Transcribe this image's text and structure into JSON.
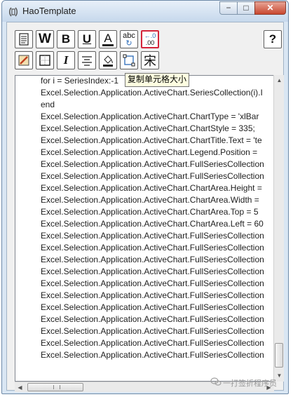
{
  "window": {
    "title": "HaoTemplate",
    "minimize_label": "−",
    "maximize_label": "□",
    "close_label": "✕"
  },
  "toolbar": {
    "bold_label": "B",
    "underline_label": "U",
    "text_color_label": "A",
    "spell_label": "abc",
    "decimal_top": "←.0",
    "decimal_bottom": ".00",
    "help_label": "?",
    "italic_label": "I",
    "font_label": "宋",
    "word_label": "W"
  },
  "tooltip": {
    "text": "复制单元格大小"
  },
  "editor": {
    "lines": [
      "for i = SeriesIndex:-1",
      "Excel.Selection.Application.ActiveChart.SeriesCollection(i).I",
      "end",
      "Excel.Selection.Application.ActiveChart.ChartType = 'xlBar",
      "Excel.Selection.Application.ActiveChart.ChartStyle = 335;",
      "Excel.Selection.Application.ActiveChart.ChartTitle.Text = 'te",
      "Excel.Selection.Application.ActiveChart.Legend.Position = ",
      "Excel.Selection.Application.ActiveChart.FullSeriesCollection",
      "Excel.Selection.Application.ActiveChart.FullSeriesCollection",
      "Excel.Selection.Application.ActiveChart.ChartArea.Height = ",
      "Excel.Selection.Application.ActiveChart.ChartArea.Width = ",
      "Excel.Selection.Application.ActiveChart.ChartArea.Top = 5",
      "Excel.Selection.Application.ActiveChart.ChartArea.Left = 60",
      "Excel.Selection.Application.ActiveChart.FullSeriesCollection",
      "Excel.Selection.Application.ActiveChart.FullSeriesCollection",
      "Excel.Selection.Application.ActiveChart.FullSeriesCollection",
      "Excel.Selection.Application.ActiveChart.FullSeriesCollection",
      "Excel.Selection.Application.ActiveChart.FullSeriesCollection",
      "Excel.Selection.Application.ActiveChart.FullSeriesCollection",
      "Excel.Selection.Application.ActiveChart.FullSeriesCollection",
      "Excel.Selection.Application.ActiveChart.FullSeriesCollection",
      "Excel.Selection.Application.ActiveChart.FullSeriesCollection",
      "Excel.Selection.Application.ActiveChart.FullSeriesCollection",
      "Excel.Selection.Application.ActiveChart.FullSeriesCollection"
    ]
  },
  "watermark": {
    "text": "一打签折程序员"
  },
  "colors": {
    "tooltip_bg": "#ffffe1",
    "pressed_border": "#d4243a",
    "title_gradient_top": "#e8f0f9",
    "title_gradient_bottom": "#c6d8ec"
  }
}
